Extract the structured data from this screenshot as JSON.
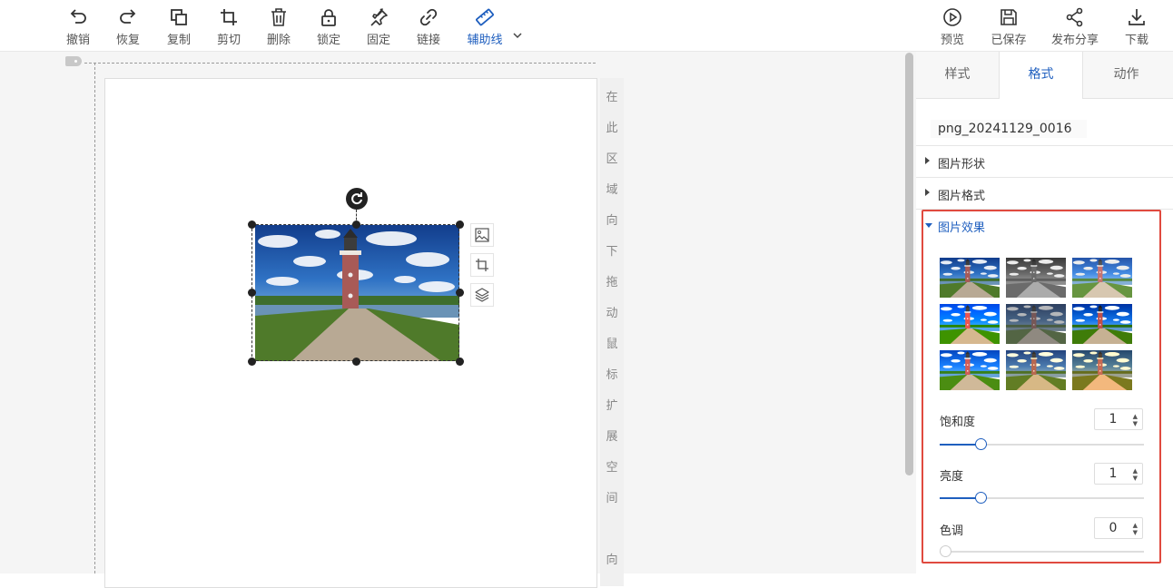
{
  "toolbar": {
    "undo": "撤销",
    "redo": "恢复",
    "copy": "复制",
    "cut": "剪切",
    "delete": "删除",
    "lock": "锁定",
    "pin": "固定",
    "link": "链接",
    "guides": "辅助线",
    "preview": "预览",
    "saved": "已保存",
    "share": "发布分享",
    "download": "下载"
  },
  "canvas": {
    "hint_chars": [
      "在",
      "此",
      "区",
      "域",
      "向",
      "下",
      "拖",
      "动",
      "鼠",
      "标",
      "扩",
      "展",
      "空",
      "间",
      "",
      "向"
    ]
  },
  "panel": {
    "tabs": [
      "样式",
      "格式",
      "动作"
    ],
    "active_tab": "格式",
    "filename": "png_20241129_0016",
    "sections": {
      "shape": "图片形状",
      "format": "图片格式",
      "effects": "图片效果"
    },
    "saturation": {
      "label": "饱和度",
      "value": "1",
      "fraction": 0.2
    },
    "brightness": {
      "label": "亮度",
      "value": "1",
      "fraction": 0.2
    },
    "hue": {
      "label": "色调",
      "value": "0",
      "fraction": 0.0
    }
  },
  "colors": {
    "accent": "#1f5fbf",
    "highlight_box": "#e04a3f"
  },
  "filter_presets": [
    "none",
    "grayscale(1)",
    "brightness(1.25) contrast(0.85)",
    "saturate(1.8) brightness(1.1)",
    "contrast(0.8) brightness(0.85) saturate(0.6)",
    "contrast(1.2) saturate(1.2)",
    "saturate(1.4) brightness(1.1)",
    "sepia(0.45) saturate(1.6)",
    "sepia(0.6) saturate(2) hue-rotate(-10deg)"
  ]
}
